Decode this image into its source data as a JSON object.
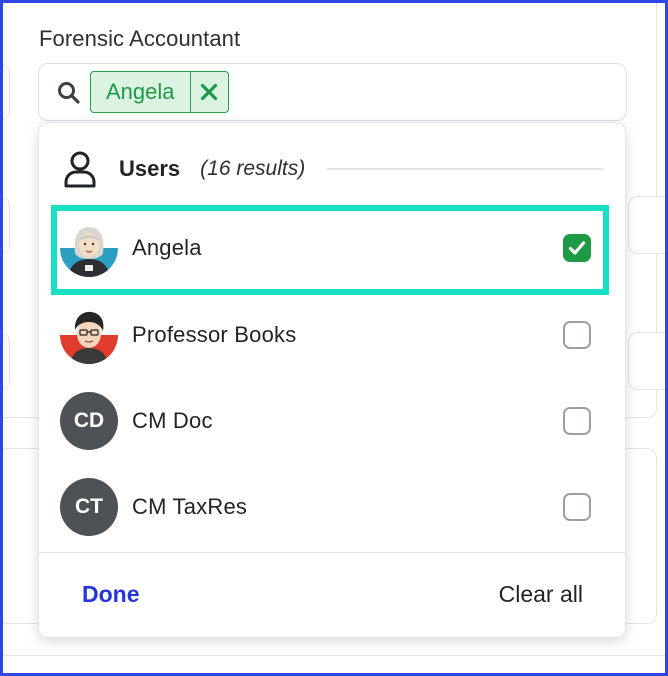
{
  "field": {
    "label": "Forensic Accountant",
    "selected_chip": "Angela"
  },
  "dropdown": {
    "group_title": "Users",
    "group_count": "(16 results)",
    "options": [
      {
        "name": "Angela",
        "avatar": "photo-angela",
        "checked": true
      },
      {
        "name": "Professor Books",
        "avatar": "photo-professor-books",
        "checked": false
      },
      {
        "name": "CM Doc",
        "initials": "CD",
        "checked": false
      },
      {
        "name": "CM TaxRes",
        "initials": "CT",
        "checked": false
      }
    ],
    "done_label": "Done",
    "clear_label": "Clear all"
  },
  "colors": {
    "accent_blue": "#2535d8",
    "chip_green": "#1e9a46",
    "highlight_teal": "#17e0c4",
    "frame_blue": "#2f47e8",
    "initials_gray": "#4e5257"
  }
}
